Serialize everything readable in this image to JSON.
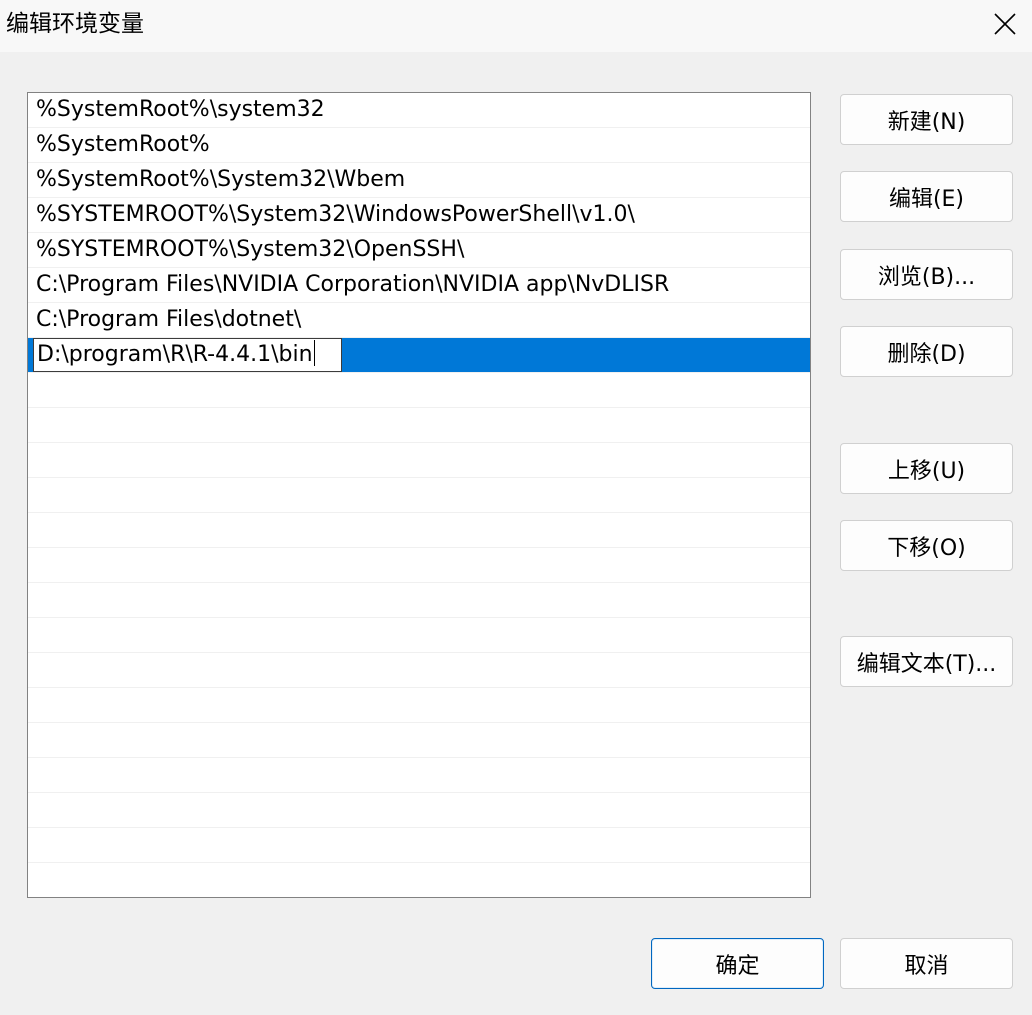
{
  "window": {
    "title": "编辑环境变量"
  },
  "list": {
    "items": [
      "%SystemRoot%\\system32",
      "%SystemRoot%",
      "%SystemRoot%\\System32\\Wbem",
      "%SYSTEMROOT%\\System32\\WindowsPowerShell\\v1.0\\",
      "%SYSTEMROOT%\\System32\\OpenSSH\\",
      "C:\\Program Files\\NVIDIA Corporation\\NVIDIA app\\NvDLISR",
      "C:\\Program Files\\dotnet\\"
    ],
    "editing_value": "D:\\program\\R\\R-4.4.1\\bin"
  },
  "buttons": {
    "new": "新建(N)",
    "edit": "编辑(E)",
    "browse": "浏览(B)...",
    "delete": "删除(D)",
    "move_up": "上移(U)",
    "move_down": "下移(O)",
    "edit_text": "编辑文本(T)...",
    "ok": "确定",
    "cancel": "取消"
  },
  "colors": {
    "selection": "#0078d7",
    "default_button_border": "#0067c0"
  },
  "icons": {
    "close": "close-icon"
  }
}
